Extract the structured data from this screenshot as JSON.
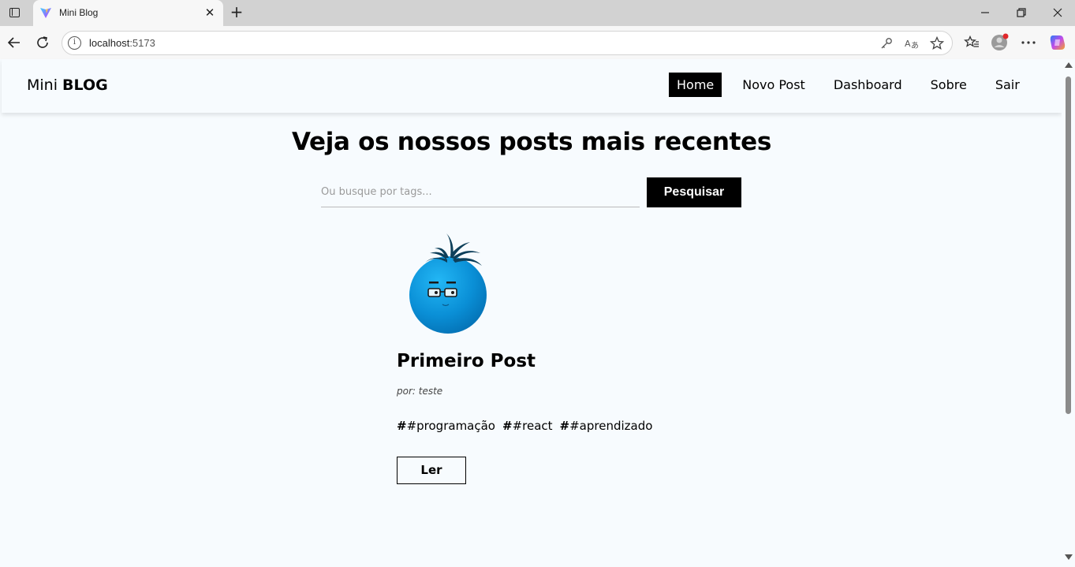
{
  "browser": {
    "tab_title": "Mini Blog",
    "url_host": "localhost",
    "url_port": ":5173"
  },
  "navbar": {
    "brand_light": "Mini ",
    "brand_bold": "BLOG",
    "links": [
      {
        "label": "Home",
        "active": true
      },
      {
        "label": "Novo Post",
        "active": false
      },
      {
        "label": "Dashboard",
        "active": false
      },
      {
        "label": "Sobre",
        "active": false
      },
      {
        "label": "Sair",
        "active": false
      }
    ]
  },
  "main": {
    "heading": "Veja os nossos posts mais recentes",
    "search": {
      "placeholder": "Ou busque por tags...",
      "value": "",
      "button_label": "Pesquisar"
    }
  },
  "posts": [
    {
      "title": "Primeiro Post",
      "author": "por: teste",
      "tags": [
        {
          "hash": "#",
          "text": "#programação"
        },
        {
          "hash": "#",
          "text": "#react"
        },
        {
          "hash": "#",
          "text": "#aprendizado"
        }
      ],
      "read_label": "Ler"
    }
  ],
  "colors": {
    "page_bg": "#f7fbfe",
    "accent": "#000000",
    "avatar_blue": "#0a8fd6"
  }
}
